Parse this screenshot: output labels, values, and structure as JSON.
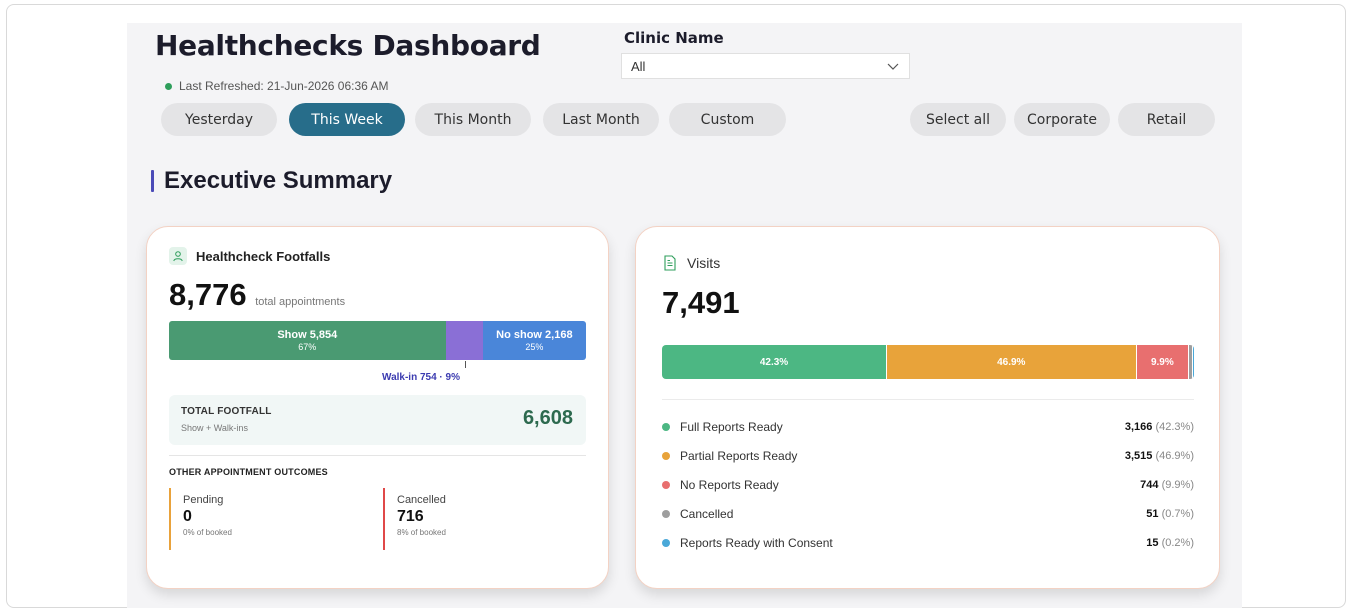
{
  "header": {
    "title": "Healthchecks Dashboard",
    "last_refreshed": "Last Refreshed: 21-Jun-2026 06:36 AM"
  },
  "clinic_filter": {
    "label": "Clinic Name",
    "selected": "All"
  },
  "date_filters": [
    {
      "label": "Yesterday",
      "active": false
    },
    {
      "label": "This Week",
      "active": true
    },
    {
      "label": "This Month",
      "active": false
    },
    {
      "label": "Last Month",
      "active": false
    },
    {
      "label": "Custom",
      "active": false
    }
  ],
  "segment_filters": [
    {
      "label": "Select all"
    },
    {
      "label": "Corporate"
    },
    {
      "label": "Retail"
    }
  ],
  "section": {
    "title": "Executive Summary"
  },
  "footfalls": {
    "title": "Healthcheck Footfalls",
    "total": "8,776",
    "total_caption": "total appointments",
    "show_label": "Show 5,854",
    "show_pct": "67%",
    "show_share": 0.67,
    "walkin_share": 0.09,
    "noshow_label": "No show 2,168",
    "noshow_pct": "25%",
    "noshow_share": 0.25,
    "walkin_label": "Walk-in 754 · 9%",
    "total_footfall_label": "TOTAL FOOTFALL",
    "total_footfall_sub": "Show + Walk-ins",
    "total_footfall_value": "6,608",
    "other_outcomes_label": "OTHER APPOINTMENT OUTCOMES",
    "pending": {
      "label": "Pending",
      "value": "0",
      "meta": "0% of booked"
    },
    "cancelled": {
      "label": "Cancelled",
      "value": "716",
      "meta": "8% of booked"
    },
    "colors": {
      "show": "#4a9a72",
      "walkin": "#8a6fd6",
      "noshow": "#4a86d9",
      "pending": "#e9a23b",
      "cancelled": "#e04848"
    }
  },
  "visits": {
    "title": "Visits",
    "total": "7,491",
    "bar": [
      {
        "label": "42.3%",
        "share": 42.3,
        "color": "#4cb783"
      },
      {
        "label": "46.9%",
        "share": 46.9,
        "color": "#e8a33a"
      },
      {
        "label": "9.9%",
        "share": 9.9,
        "color": "#e86f6f"
      },
      {
        "label": "",
        "share": 0.7,
        "color": "#9e9e9e"
      },
      {
        "label": "",
        "share": 0.2,
        "color": "#4aa8d8"
      }
    ],
    "legend": [
      {
        "label": "Full Reports Ready",
        "value": "3,166",
        "pct": "(42.3%)",
        "color": "#4cb783"
      },
      {
        "label": "Partial Reports Ready",
        "value": "3,515",
        "pct": "(46.9%)",
        "color": "#e8a33a"
      },
      {
        "label": "No Reports Ready",
        "value": "744",
        "pct": "(9.9%)",
        "color": "#e86f6f"
      },
      {
        "label": "Cancelled",
        "value": "51",
        "pct": "(0.7%)",
        "color": "#9e9e9e"
      },
      {
        "label": "Reports Ready with Consent",
        "value": "15",
        "pct": "(0.2%)",
        "color": "#4aa8d8"
      }
    ]
  }
}
